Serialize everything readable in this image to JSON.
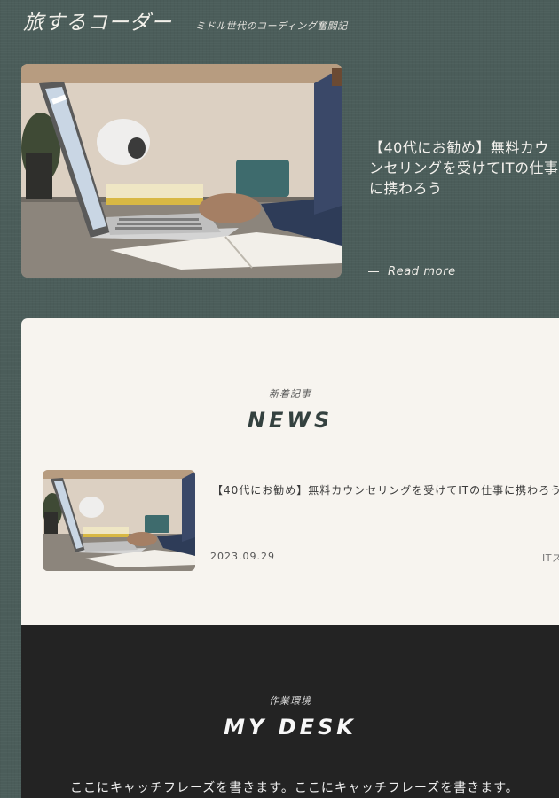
{
  "header": {
    "site_title": "旅するコーダー",
    "tagline": "ミドル世代のコーディング奮闘記"
  },
  "hero": {
    "article_title": "【40代にお勧め】無料カウンセリングを受けてITの仕事に携わろう",
    "read_more": "Read more"
  },
  "news": {
    "subheading": "新着記事",
    "heading": "NEWS",
    "items": [
      {
        "title": "【40代にお勧め】無料カウンセリングを受けてITの仕事に携わろう",
        "date": "2023.09.29",
        "category": "ITス"
      }
    ]
  },
  "desk": {
    "subheading": "作業環境",
    "heading": "MY DESK",
    "catch": "ここにキャッチフレーズを書きます。ここにキャッチフレーズを書きます。"
  },
  "colors": {
    "background": "#4b5d5a",
    "panel_light": "#f7f4ef",
    "panel_dark": "#232323",
    "heading_dark": "#34413f"
  }
}
